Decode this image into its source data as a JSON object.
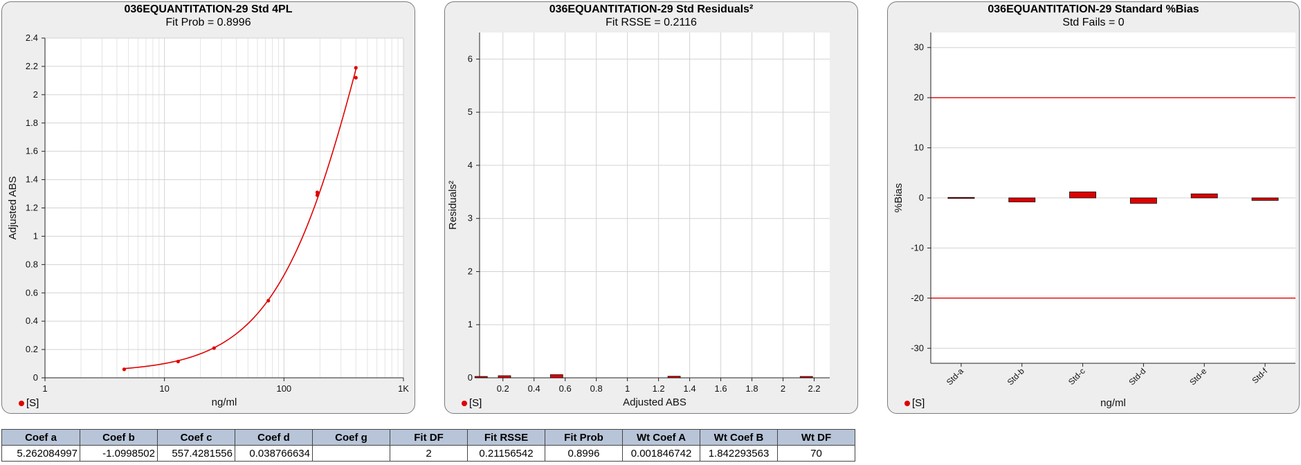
{
  "panels": [
    {
      "title": "036EQUANTITATION-29  Std 4PL",
      "subtitle": "Fit Prob = 0.8996",
      "legend": "[S]"
    },
    {
      "title": "036EQUANTITATION-29  Std  Residuals²",
      "subtitle": "Fit RSSE = 0.2116",
      "legend": "[S]"
    },
    {
      "title": "036EQUANTITATION-29  Standard %Bias",
      "subtitle": "Std Fails = 0",
      "legend": "[S]"
    }
  ],
  "chart_data": [
    {
      "type": "scatter",
      "title": "036EQUANTITATION-29  Std 4PL",
      "subtitle": "Fit Prob = 0.8996",
      "xlabel": "ng/ml",
      "ylabel": "Adjusted ABS",
      "xscale": "log",
      "xlim": [
        1,
        1000
      ],
      "ylim": [
        0,
        2.4
      ],
      "xticks": [
        "1",
        "10",
        "100",
        "1K"
      ],
      "yticks": [
        "0",
        "0.2",
        "0.4",
        "0.6",
        "0.8",
        "1",
        "1.2",
        "1.4",
        "1.6",
        "1.8",
        "2",
        "2.2",
        "2.4"
      ],
      "grid": true,
      "legend": "bottom-left",
      "series": [
        {
          "name": "[S]",
          "color": "#e00000",
          "x": [
            4.6,
            13,
            26,
            74,
            190,
            190,
            400,
            400
          ],
          "y": [
            0.06,
            0.115,
            0.21,
            0.545,
            1.29,
            1.31,
            2.12,
            2.19
          ]
        }
      ],
      "fit": {
        "model": "4PL",
        "a": 5.262084997,
        "b": -1.0998502,
        "c": 557.4281556,
        "d": 0.038766634,
        "x_range": [
          4.6,
          400
        ]
      }
    },
    {
      "type": "bar",
      "title": "036EQUANTITATION-29  Std  Residuals²",
      "subtitle": "Fit RSSE = 0.2116",
      "xlabel": "Adjusted ABS",
      "ylabel": "Residuals²",
      "xlim": [
        0.05,
        2.3
      ],
      "ylim": [
        0,
        6.5
      ],
      "xticks": [
        "0.2",
        "0.4",
        "0.6",
        "0.8",
        "1",
        "1.2",
        "1.4",
        "1.6",
        "1.8",
        "2",
        "2.2"
      ],
      "yticks": [
        "0",
        "1",
        "2",
        "3",
        "4",
        "5",
        "6"
      ],
      "grid": true,
      "legend": "bottom-left",
      "series": [
        {
          "name": "[S]",
          "color": "#e00000",
          "x": [
            0.06,
            0.21,
            0.545,
            1.3,
            2.15
          ],
          "y": [
            0.005,
            0.04,
            0.06,
            0.03,
            0.005
          ]
        }
      ]
    },
    {
      "type": "bar",
      "title": "036EQUANTITATION-29  Standard %Bias",
      "subtitle": "Std Fails = 0",
      "xlabel": "ng/ml",
      "ylabel": "%Bias",
      "categories": [
        "Std-a",
        "Std-b",
        "Std-c",
        "Std-d",
        "Std-e",
        "Std-f"
      ],
      "ylim": [
        -33,
        33
      ],
      "yticks": [
        "30",
        "20",
        "10",
        "0",
        "-10",
        "-20",
        "-30"
      ],
      "grid": true,
      "legend": "bottom-left",
      "limits": [
        20,
        -20
      ],
      "limit_color": "#e00000",
      "series": [
        {
          "name": "[S]",
          "color": "#e00000",
          "values": [
            0.1,
            -0.8,
            1.2,
            -1.1,
            0.8,
            -0.5
          ]
        }
      ]
    }
  ],
  "table": {
    "headers": [
      "Coef a",
      "Coef b",
      "Coef c",
      "Coef d",
      "Coef g",
      "Fit DF",
      "Fit RSSE",
      "Fit Prob",
      "Wt Coef A",
      "Wt Coef B",
      "Wt DF"
    ],
    "row": [
      "5.262084997",
      "-1.0998502",
      "557.4281556",
      "0.038766634",
      "",
      "2",
      "0.21156542",
      "0.8996",
      "0.001846742",
      "1.842293563",
      "70"
    ]
  }
}
